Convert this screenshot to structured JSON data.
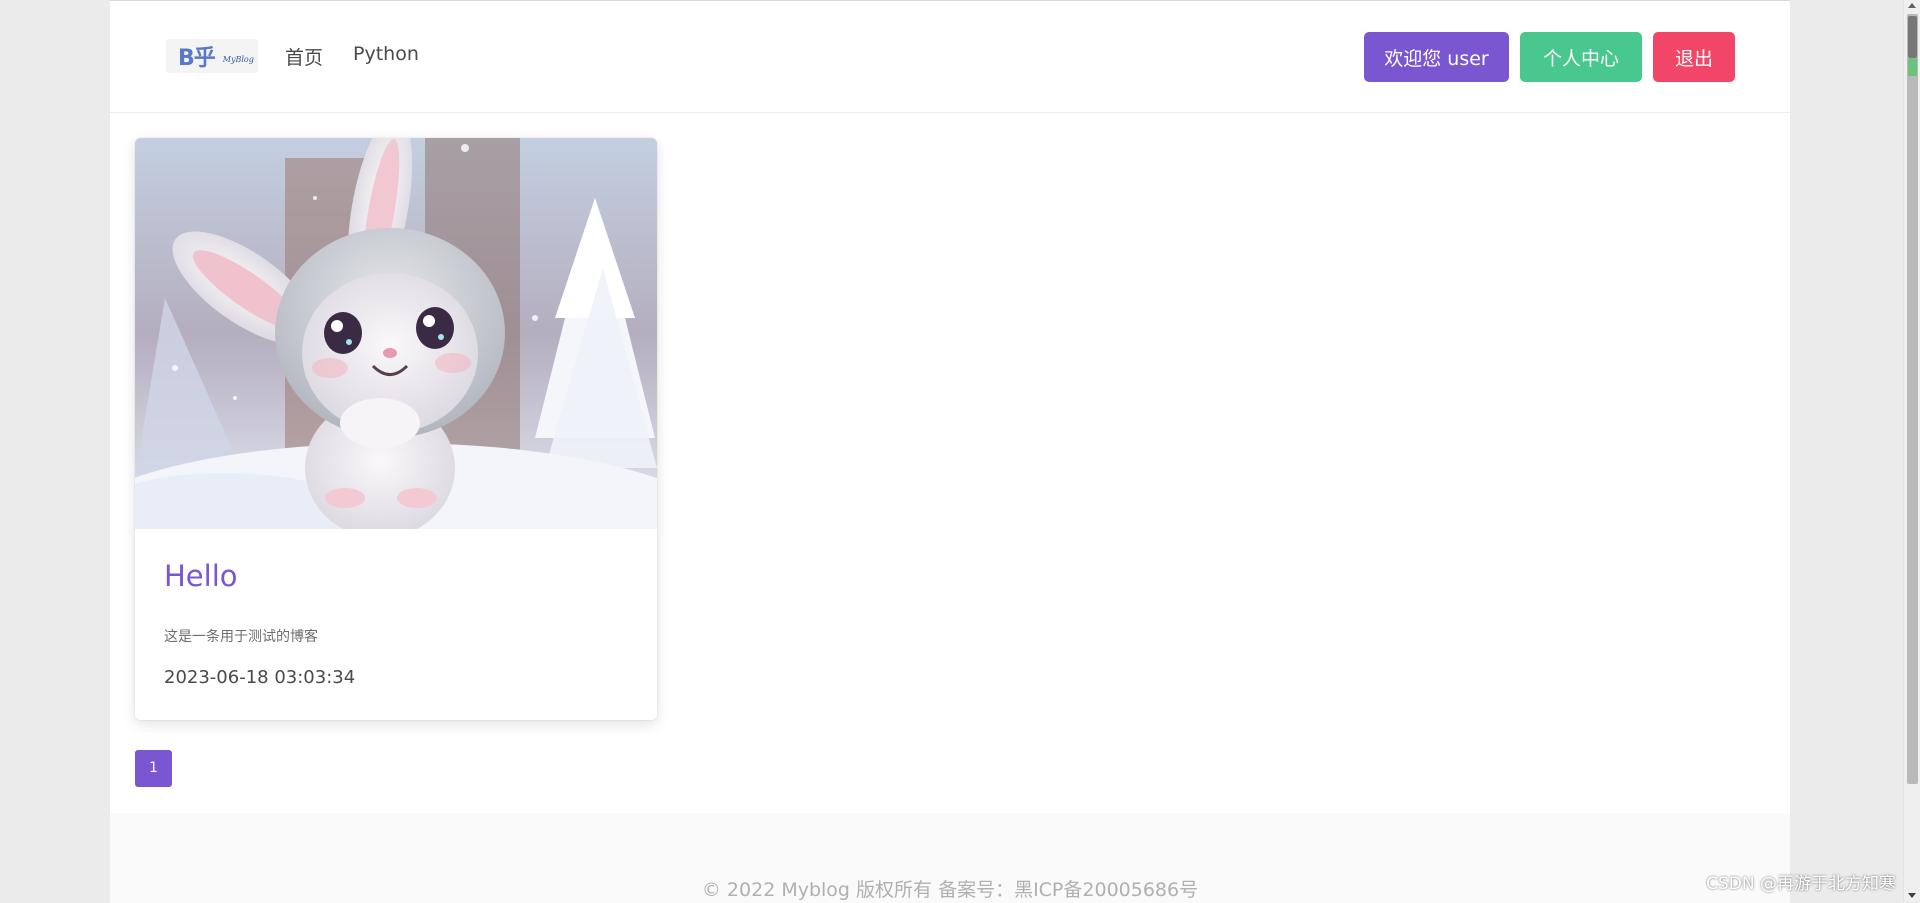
{
  "header": {
    "logo_text": "B乎",
    "logo_sub": "MyBlog",
    "nav": [
      {
        "label": "首页"
      },
      {
        "label": "Python"
      }
    ],
    "buttons": {
      "welcome": "欢迎您 user",
      "center": "个人中心",
      "logout": "退出"
    }
  },
  "post": {
    "title": "Hello",
    "description": "这是一条用于测试的博客",
    "date": "2023-06-18 03:03:34"
  },
  "pagination": {
    "current": "1"
  },
  "footer": {
    "text": "© 2022 Myblog 版权所有 备案号：黑ICP备20005686号"
  },
  "watermark": "CSDN @再游于北方知寒",
  "colors": {
    "primary": "#7a57d1",
    "success": "#48c78e",
    "danger": "#f14668"
  }
}
